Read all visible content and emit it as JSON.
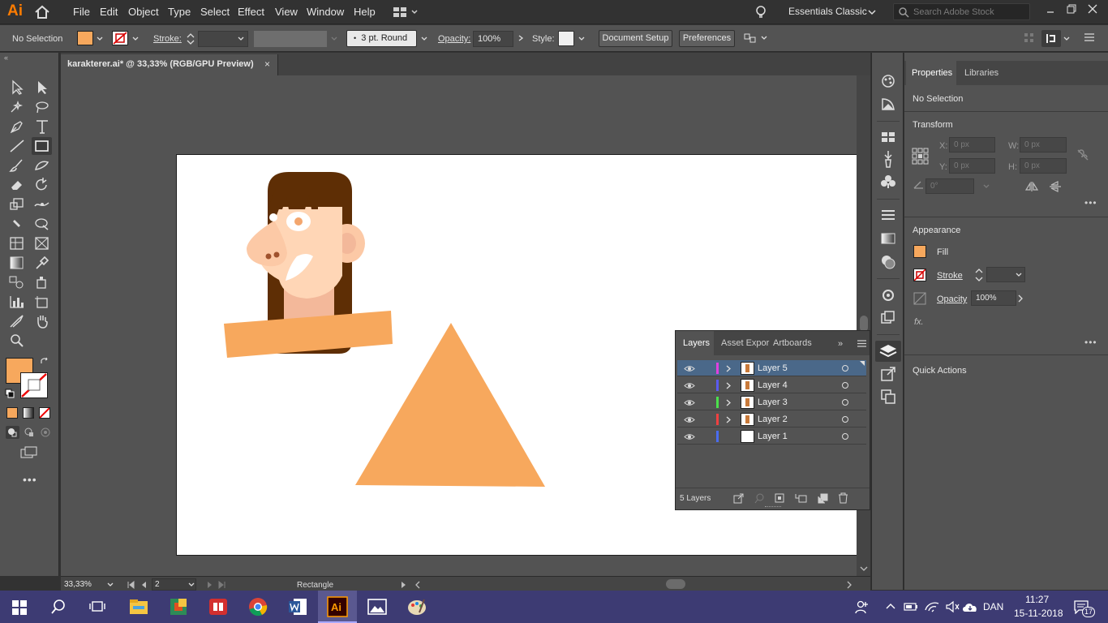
{
  "app": {
    "logo": "Ai",
    "menus": [
      "File",
      "Edit",
      "Object",
      "Type",
      "Select",
      "Effect",
      "View",
      "Window",
      "Help"
    ],
    "workspace": "Essentials Classic",
    "search_placeholder": "Search Adobe Stock"
  },
  "control_bar": {
    "selection": "No Selection",
    "stroke_label": "Stroke:",
    "brush": "3 pt. Round",
    "opacity_label": "Opacity:",
    "opacity_value": "100%",
    "style_label": "Style:",
    "document_setup": "Document Setup",
    "preferences": "Preferences",
    "fill_color": "#f7a85d"
  },
  "document": {
    "tab_title": "karakterer.ai* @ 33,33% (RGB/GPU Preview)",
    "close": "×"
  },
  "status_bar": {
    "zoom": "33,33%",
    "artboard_number": "2",
    "current_tool": "Rectangle"
  },
  "layers_panel": {
    "tabs": [
      "Layers",
      "Asset Expor",
      "Artboards"
    ],
    "layers": [
      {
        "name": "Layer 5",
        "color": "#e040e0",
        "selected": true
      },
      {
        "name": "Layer 4",
        "color": "#5a5af0",
        "selected": false
      },
      {
        "name": "Layer 3",
        "color": "#4ce04c",
        "selected": false
      },
      {
        "name": "Layer 2",
        "color": "#f04040",
        "selected": false
      },
      {
        "name": "Layer 1",
        "color": "#4a6cf0",
        "selected": false
      }
    ],
    "count": "5 Layers"
  },
  "properties": {
    "tabs": [
      "Properties",
      "Libraries"
    ],
    "selection": "No Selection",
    "transform_title": "Transform",
    "x_label": "X:",
    "x_value": "0 px",
    "y_label": "Y:",
    "y_value": "0 px",
    "w_label": "W:",
    "w_value": "0 px",
    "h_label": "H:",
    "h_value": "0 px",
    "angle_value": "0°",
    "appearance_title": "Appearance",
    "fill_label": "Fill",
    "stroke_label": "Stroke",
    "opacity_label": "Opacity",
    "opacity_value": "100%",
    "fx": "fx.",
    "quick_actions": "Quick Actions"
  },
  "taskbar": {
    "language": "DAN",
    "time": "11:27",
    "date": "15-11-2018",
    "notifications": "17"
  },
  "artwork_colors": {
    "hair": "#5e2e05",
    "skin": "#ffd6b6",
    "skin_shadow": "#f3b89a",
    "shirt": "#f7a85d",
    "nostril": "#a0522d",
    "eye_iris": "#f3a66e"
  }
}
